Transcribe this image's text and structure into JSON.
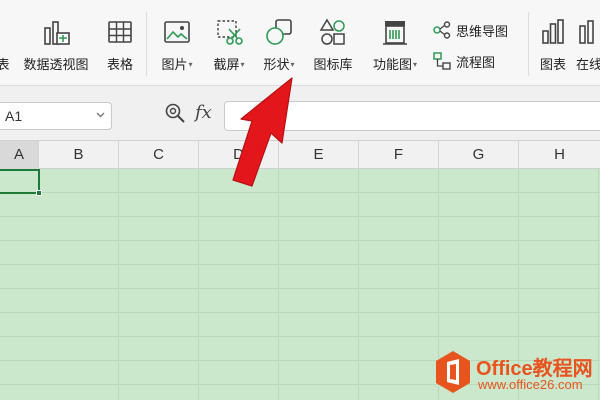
{
  "ribbon": {
    "items": [
      {
        "label": "表"
      },
      {
        "label": "数据透视图"
      },
      {
        "label": "表格"
      },
      {
        "label": "图片"
      },
      {
        "label": "截屏"
      },
      {
        "label": "形状"
      },
      {
        "label": "图标库"
      },
      {
        "label": "功能图"
      },
      {
        "label": "思维导图"
      },
      {
        "label": "流程图"
      },
      {
        "label": "图表"
      },
      {
        "label": "在线"
      }
    ]
  },
  "formula_bar": {
    "cell_reference": "A1",
    "fx_label": "fx",
    "value": ""
  },
  "columns": [
    "A",
    "B",
    "C",
    "D",
    "E",
    "F",
    "G",
    "H"
  ],
  "selected_cell": "A1",
  "watermark": {
    "text": "Office教程网",
    "url": "www.office26.com"
  },
  "colors": {
    "sheet_fill": "#cbe8cd",
    "arrow": "#e3171b",
    "watermark": "#e8541e",
    "selection": "#1f7a3a"
  }
}
